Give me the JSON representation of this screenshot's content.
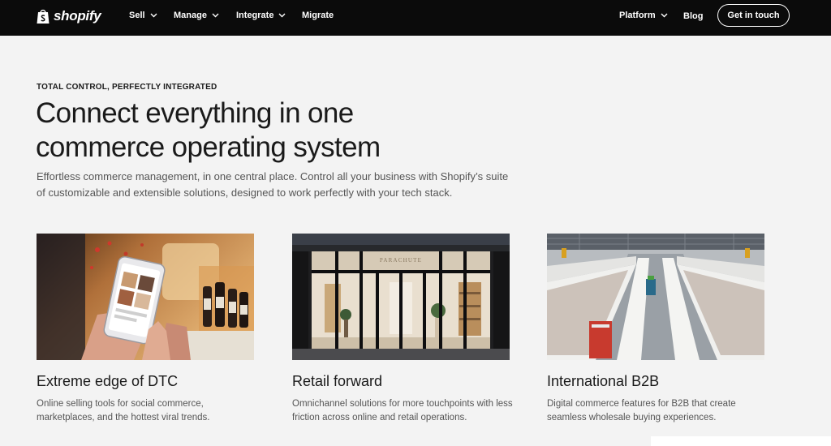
{
  "nav": {
    "logo_text": "shopify",
    "items": [
      {
        "label": "Sell",
        "dropdown": true
      },
      {
        "label": "Manage",
        "dropdown": true
      },
      {
        "label": "Integrate",
        "dropdown": true
      },
      {
        "label": "Migrate",
        "dropdown": false
      }
    ],
    "platform_label": "Platform",
    "blog_label": "Blog",
    "cta_label": "Get in touch"
  },
  "hero": {
    "eyebrow": "TOTAL CONTROL, PERFECTLY INTEGRATED",
    "headline_line1": "Connect everything in one",
    "headline_line2": "commerce operating system",
    "intro_line1": "Effortless commerce management, in one central place. Control all your business with Shopify’s suite",
    "intro_line2": "of customizable and extensible solutions, designed to work perfectly with your tech stack."
  },
  "cards": [
    {
      "title": "Extreme edge of DTC",
      "desc_line1": "Online selling tools for social commerce,",
      "desc_line2": "marketplaces, and the hottest viral trends."
    },
    {
      "title": "Retail forward",
      "desc_line1": "Omnichannel solutions for more touchpoints with less",
      "desc_line2": "friction across online and retail operations.",
      "storefront_sign": "PARACHUTE"
    },
    {
      "title": "International B2B",
      "desc_line1": "Digital commerce features for B2B that create",
      "desc_line2": "seamless wholesale buying experiences."
    }
  ],
  "colors": {
    "nav_bg": "#0b0b0b",
    "page_bg": "#f3f3f3",
    "text": "#1a1a1a",
    "muted": "#555555"
  }
}
